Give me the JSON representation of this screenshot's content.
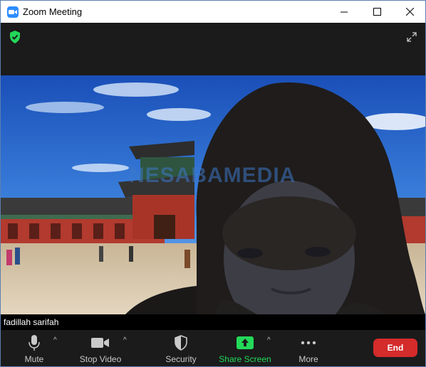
{
  "window": {
    "title": "Zoom Meeting",
    "icons": {
      "app": "zoom-camera-icon",
      "minimize": "minimize-icon",
      "maximize": "maximize-icon",
      "close": "close-icon"
    }
  },
  "meeting": {
    "encryption_icon": "shield-check-icon",
    "fullscreen_icon": "expand-icon",
    "participant_name": "fadillah sarifah",
    "watermark": "NESABAMEDIA"
  },
  "toolbar": {
    "mute_label": "Mute",
    "stop_video_label": "Stop Video",
    "security_label": "Security",
    "share_screen_label": "Share Screen",
    "more_label": "More",
    "end_label": "End",
    "caret": "^"
  },
  "colors": {
    "accent_green": "#23d959",
    "end_red": "#d42b2b",
    "zoom_blue": "#2d8cff"
  }
}
